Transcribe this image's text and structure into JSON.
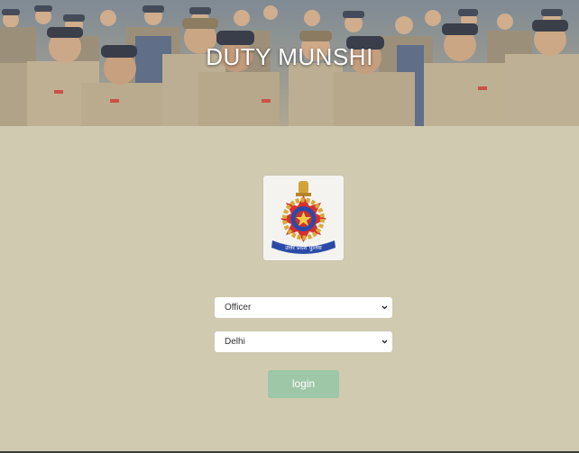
{
  "header": {
    "title": "DUTY MUNSHI"
  },
  "logo": {
    "emblem_text": "उत्तर प्रदेश पुलिस",
    "icon": "police-emblem-icon"
  },
  "form": {
    "role_select": {
      "selected": "Officer",
      "icon": "chevron-down-icon"
    },
    "city_select": {
      "selected": "Delhi",
      "icon": "chevron-down-icon"
    },
    "login_label": "login"
  },
  "colors": {
    "background": "#cfcab0",
    "login_button": "#9dc7a6",
    "select_background": "#ffffff",
    "title_text": "#ffffff"
  }
}
